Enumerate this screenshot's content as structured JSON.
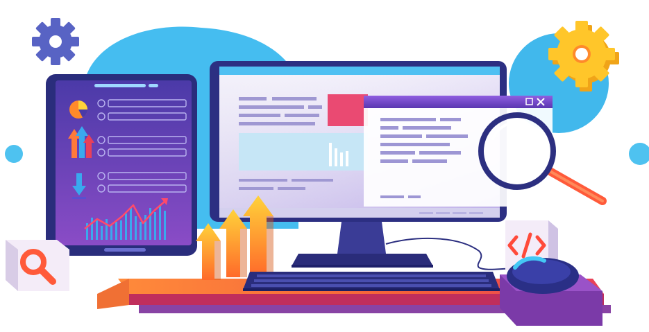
{
  "illustration": {
    "colors": {
      "blue_blob": "#3ab7e8",
      "blue_blob_light": "#5ccaf2",
      "tablet_frame": "#2b2e7c",
      "tablet_screen_top": "#5a3fb8",
      "tablet_screen_bottom": "#8b4fc7",
      "monitor_frame": "#2c2f80",
      "monitor_screen": "#f1eef8",
      "window_bar": "#7b5fd0",
      "accent_red": "#ea4a6a",
      "accent_orange": "#ff8a2a",
      "accent_yellow": "#ffd23a",
      "desk_orange": "#ff7a3a",
      "desk_red": "#e6405a",
      "desk_purple": "#7e3fb8",
      "gear_blue": "#5a63c6",
      "gear_yellow": "#ffc021",
      "mouse": "#2a2f86"
    },
    "icons": [
      "gear-icon",
      "gear-icon",
      "pie-chart-icon",
      "arrow-up-icon",
      "arrow-down-icon",
      "magnifier-icon",
      "search-icon",
      "code-icon",
      "window-minimize-icon",
      "window-close-icon"
    ]
  }
}
